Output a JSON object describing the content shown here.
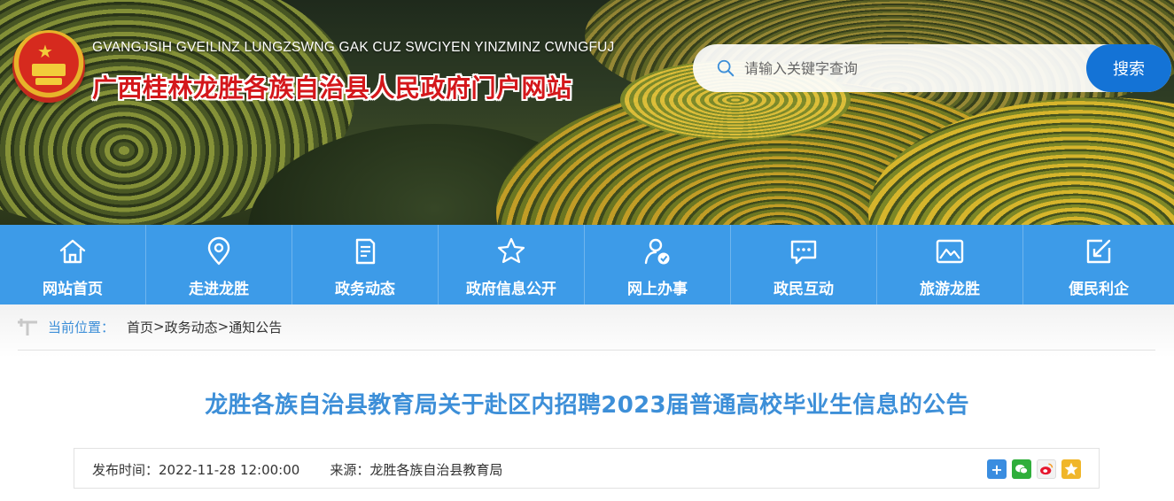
{
  "header": {
    "site_name_en": "GVANGJSIH GVEILINZ LUNGZSWNG GAK CUZ SWCIYEN YINZMINZ CWNGFUJ",
    "site_name_cn": "广西桂林龙胜各族自治县人民政府门户网站",
    "emblem_icon": "national-emblem-icon"
  },
  "search": {
    "placeholder": "请输入关键字查询",
    "button_label": "搜索",
    "icon": "search-icon"
  },
  "nav": {
    "items": [
      {
        "label": "网站首页",
        "icon": "home-icon"
      },
      {
        "label": "走进龙胜",
        "icon": "location-pin-icon"
      },
      {
        "label": "政务动态",
        "icon": "document-icon"
      },
      {
        "label": "政府信息公开",
        "icon": "star-icon"
      },
      {
        "label": "网上办事",
        "icon": "user-service-icon"
      },
      {
        "label": "政民互动",
        "icon": "chat-bubble-icon"
      },
      {
        "label": "旅游龙胜",
        "icon": "landscape-icon"
      },
      {
        "label": "便民利企",
        "icon": "edit-icon"
      }
    ],
    "background": "#3d9be8"
  },
  "breadcrumb": {
    "label": "当前位置：",
    "items": [
      "首页",
      "政务动态",
      "通知公告"
    ],
    "separator": ">"
  },
  "article": {
    "title": "龙胜各族自治县教育局关于赴区内招聘2023届普通高校毕业生信息的公告",
    "publish_label": "发布时间：",
    "publish_time": "2022-11-28 12:00:00",
    "source_label": "来源：",
    "source": "龙胜各族自治县教育局"
  },
  "share": {
    "icons": [
      "share-plus-icon",
      "wechat-icon",
      "weibo-icon",
      "qzone-icon"
    ]
  },
  "colors": {
    "accent": "#3d8fd8",
    "site_name_red": "#d4171b",
    "search_button": "#1473d6"
  }
}
